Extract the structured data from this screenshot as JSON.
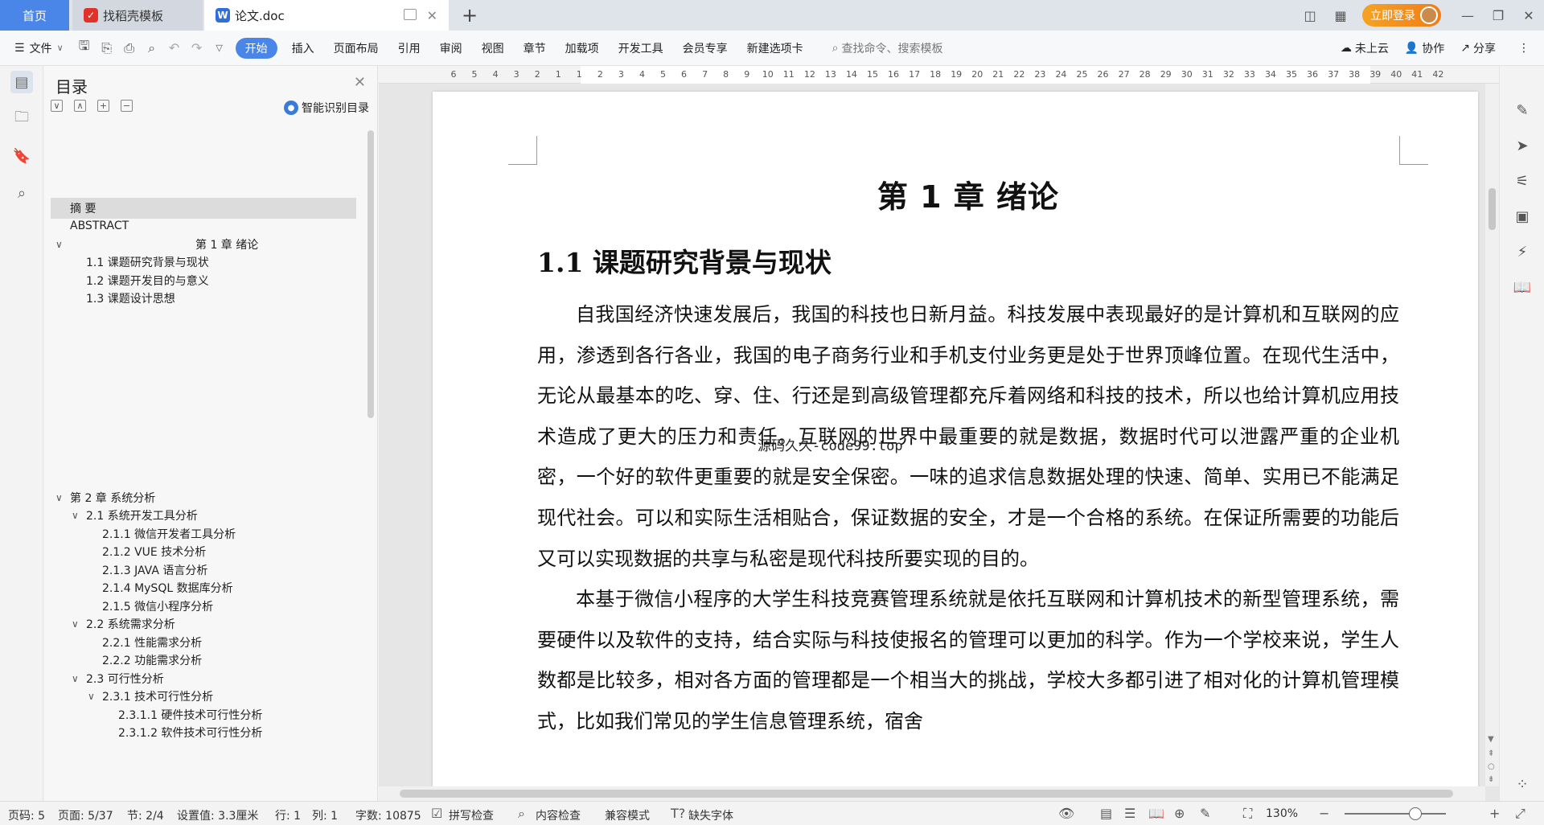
{
  "tabs": {
    "home": "首页",
    "template": "找稻壳模板",
    "document": "论文.doc"
  },
  "titlebar": {
    "login": "立即登录"
  },
  "menu": {
    "file": "文件",
    "items": [
      "开始",
      "插入",
      "页面布局",
      "引用",
      "审阅",
      "视图",
      "章节",
      "加载项",
      "开发工具",
      "会员专享",
      "新建选项卡"
    ],
    "search_placeholder": "查找命令、搜索模板",
    "cloud": "未上云",
    "collab": "协作",
    "share": "分享"
  },
  "toc": {
    "title": "目录",
    "smart": "智能识别目录",
    "items": [
      {
        "text": "摘  要"
      },
      {
        "text": "ABSTRACT"
      },
      {
        "text": "第 1 章  绪论"
      },
      {
        "text": "1.1  课题研究背景与现状"
      },
      {
        "text": "1.2 课题开发目的与意义"
      },
      {
        "text": "1.3  课题设计思想"
      },
      {
        "text": "第 2 章  系统分析"
      },
      {
        "text": "2.1  系统开发工具分析"
      },
      {
        "text": "2.1.1  微信开发者工具分析"
      },
      {
        "text": "2.1.2 VUE 技术分析"
      },
      {
        "text": "2.1.3 JAVA 语言分析"
      },
      {
        "text": "2.1.4 MySQL 数据库分析"
      },
      {
        "text": "2.1.5 微信小程序分析"
      },
      {
        "text": "2.2 系统需求分析"
      },
      {
        "text": "2.2.1  性能需求分析"
      },
      {
        "text": "2.2.2  功能需求分析"
      },
      {
        "text": "2.3 可行性分析"
      },
      {
        "text": "2.3.1  技术可行性分析"
      },
      {
        "text": "2.3.1.1 硬件技术可行性分析"
      },
      {
        "text": "2.3.1.2 软件技术可行性分析"
      }
    ]
  },
  "ruler": {
    "ticks": [
      "6",
      "5",
      "4",
      "3",
      "2",
      "1",
      "1",
      "2",
      "3",
      "4",
      "5",
      "6",
      "7",
      "8",
      "9",
      "10",
      "11",
      "12",
      "13",
      "14",
      "15",
      "16",
      "17",
      "18",
      "19",
      "20",
      "21",
      "22",
      "23",
      "24",
      "25",
      "26",
      "27",
      "28",
      "29",
      "30",
      "31",
      "32",
      "33",
      "34",
      "35",
      "36",
      "37",
      "38",
      "39",
      "40",
      "41",
      "42"
    ]
  },
  "document": {
    "chapter_title": "第 1 章  绪论",
    "section_title": "1.1  课题研究背景与现状",
    "paragraph1": "自我国经济快速发展后，我国的科技也日新月益。科技发展中表现最好的是计算机和互联网的应用，渗透到各行各业，我国的电子商务行业和手机支付业务更是处于世界顶峰位置。在现代生活中，无论从最基本的吃、穿、住、行还是到高级管理都充斥着网络和科技的技术，所以也给计算机应用技术造成了更大的压力和责任。互联网的世界中最重要的就是数据，数据时代可以泄露严重的企业机密，一个好的软件更重要的就是安全保密。一味的追求信息数据处理的快速、简单、实用已不能满足现代社会。可以和实际生活相贴合，保证数据的安全，才是一个合格的系统。在保证所需要的功能后又可以实现数据的共享与私密是现代科技所要实现的目的。",
    "paragraph2": "本基于微信小程序的大学生科技竞赛管理系统就是依托互联网和计算机技术的新型管理系统，需要硬件以及软件的支持，结合实际与科技使报名的管理可以更加的科学。作为一个学校来说，学生人数都是比较多，相对各方面的管理都是一个相当大的挑战，学校大多都引进了相对化的计算机管理模式，比如我们常见的学生信息管理系统，宿舍",
    "watermark": "源码久久-code99.top"
  },
  "status": {
    "page_code": "页码: 5",
    "page": "页面: 5/37",
    "section": "节: 2/4",
    "setting": "设置值: 3.3厘米",
    "row": "行: 1",
    "col": "列: 1",
    "words": "字数: 10875",
    "spell": "拼写检查",
    "content_check": "内容检查",
    "compat": "兼容模式",
    "missing_font": "缺失字体",
    "zoom": "130%"
  }
}
